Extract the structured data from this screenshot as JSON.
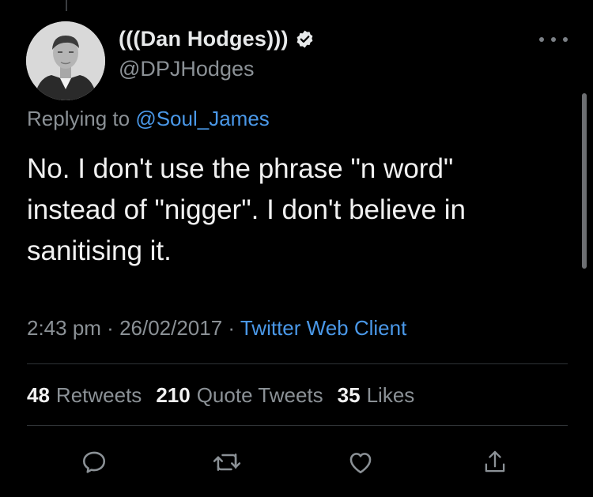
{
  "author": {
    "display_name": "(((Dan Hodges)))",
    "handle": "@DPJHodges",
    "verified": true
  },
  "reply": {
    "prefix": "Replying to",
    "mention": "@Soul_James"
  },
  "tweet": {
    "text": "No. I don't use the phrase \"n word\"\ninstead of \"nigger\". I don't believe in\nsanitising it."
  },
  "meta": {
    "time": "2:43 pm",
    "sep1": " · ",
    "date": "26/02/2017",
    "sep2": " · ",
    "source": "Twitter Web Client"
  },
  "stats": {
    "retweets_count": "48",
    "retweets_label": "Retweets",
    "quotes_count": "210",
    "quotes_label": "Quote Tweets",
    "likes_count": "35",
    "likes_label": "Likes"
  },
  "icons": {
    "more": "more-icon",
    "reply": "reply-icon",
    "retweet": "retweet-icon",
    "like": "like-icon",
    "share": "share-icon",
    "verified": "verified-badge-icon"
  },
  "colors": {
    "background": "#000000",
    "text": "#e7e9ea",
    "muted": "#8b9196",
    "link": "#4a98e8"
  }
}
